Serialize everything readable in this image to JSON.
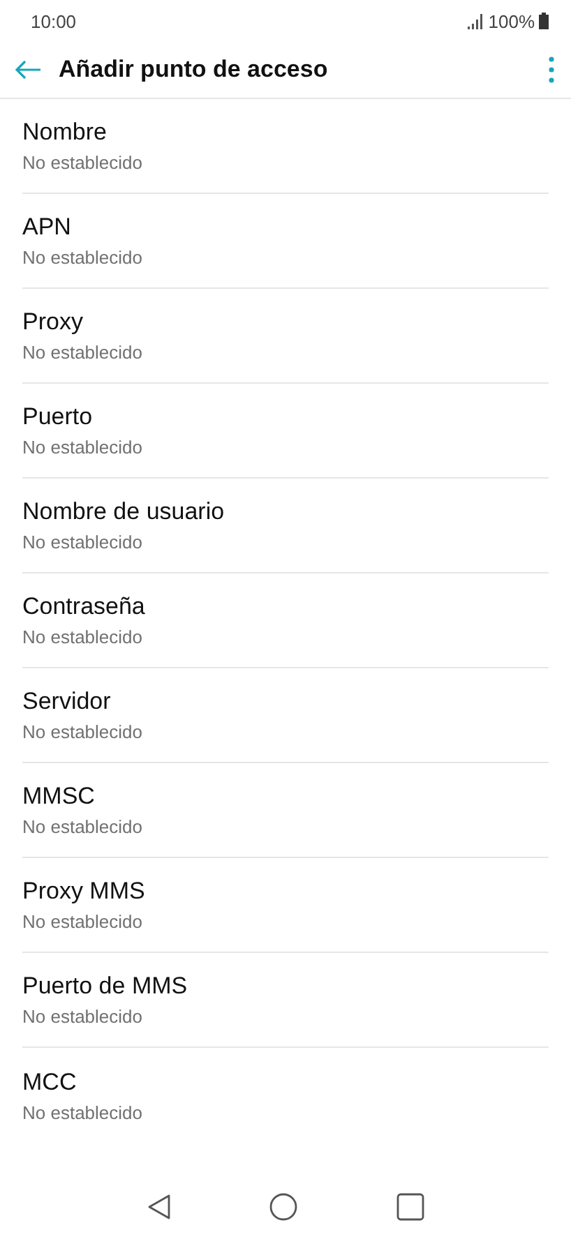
{
  "status_bar": {
    "time": "10:00",
    "battery": "100%"
  },
  "app_bar": {
    "title": "Añadir punto de acceso"
  },
  "settings": [
    {
      "label": "Nombre",
      "value": "No establecido"
    },
    {
      "label": "APN",
      "value": "No establecido"
    },
    {
      "label": "Proxy",
      "value": "No establecido"
    },
    {
      "label": "Puerto",
      "value": "No establecido"
    },
    {
      "label": "Nombre de usuario",
      "value": "No establecido"
    },
    {
      "label": "Contraseña",
      "value": "No establecido"
    },
    {
      "label": "Servidor",
      "value": "No establecido"
    },
    {
      "label": "MMSC",
      "value": "No establecido"
    },
    {
      "label": "Proxy MMS",
      "value": "No establecido"
    },
    {
      "label": "Puerto de MMS",
      "value": "No establecido"
    },
    {
      "label": "MCC",
      "value": "No establecido"
    }
  ]
}
